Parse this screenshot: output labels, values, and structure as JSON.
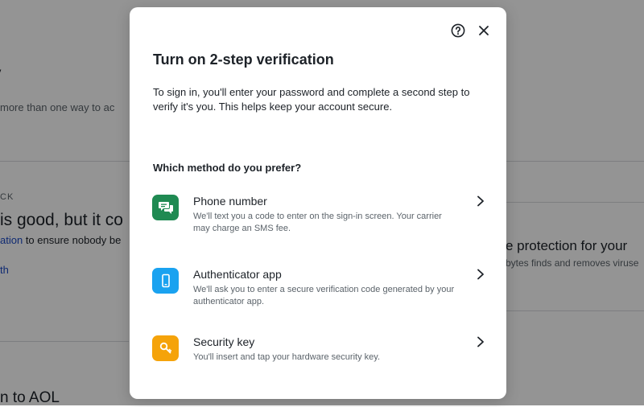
{
  "background": {
    "heading_fragment": "y",
    "subtitle_fragment": "more than one way to ac",
    "eyebrow_fragment": "CK",
    "big_fragment": "is good, but it co",
    "line_link_fragment": "ation",
    "line_rest_fragment": " to ensure nobody be",
    "link2_fragment": "th",
    "right_title_fragment": "e protection for your",
    "right_sub_fragment": "bytes finds and removes viruse",
    "bottom_fragment": "n to AOL"
  },
  "modal": {
    "title": "Turn on 2-step verification",
    "description": "To sign in, you'll enter your password and complete a second step to verify it's you. This helps keep your account secure.",
    "prompt": "Which method do you prefer?",
    "help_icon": "help-circle-icon",
    "close_icon": "close-icon",
    "options": [
      {
        "title": "Phone number",
        "description": "We'll text you a code to enter on the sign-in screen. Your carrier may charge an SMS fee.",
        "icon": "chat-bubbles-icon",
        "color": "#1f8a52"
      },
      {
        "title": "Authenticator app",
        "description": "We'll ask you to enter a secure verification code generated by your authenticator app.",
        "icon": "smartphone-icon",
        "color": "#1aa2f0"
      },
      {
        "title": "Security key",
        "description": "You'll insert and tap your hardware security key.",
        "icon": "key-icon",
        "color": "#f5a30a"
      }
    ]
  }
}
